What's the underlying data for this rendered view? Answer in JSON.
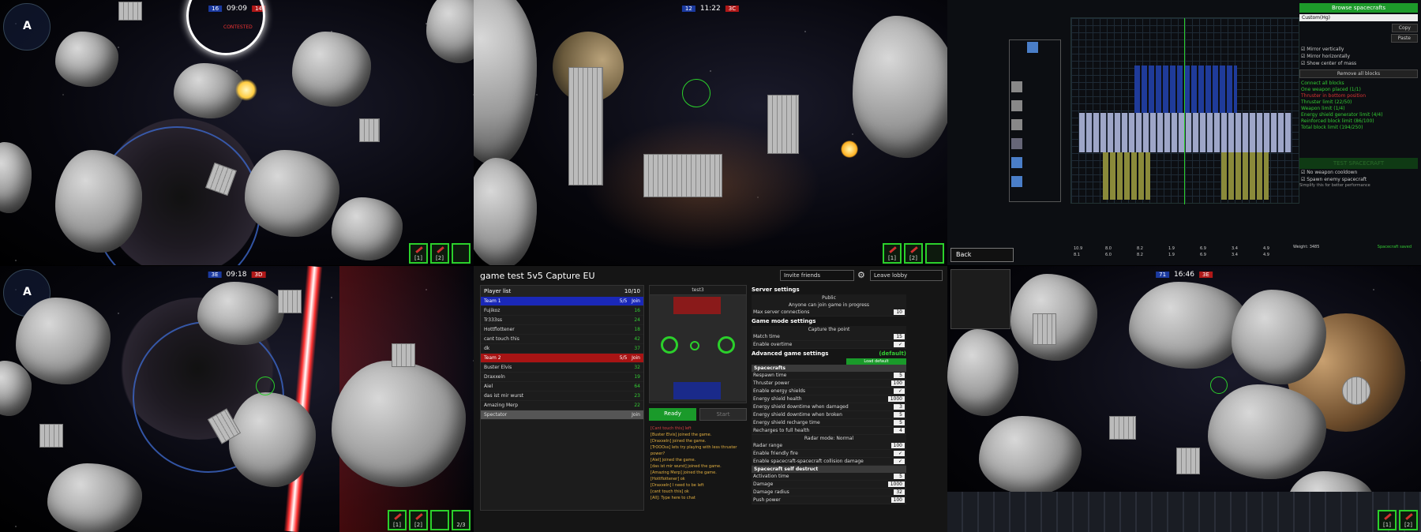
{
  "panels": {
    "tl": {
      "timer": "09:09",
      "team_blue": "16",
      "team_red": "14",
      "status": "CONTESTED",
      "weapons": [
        "[1]",
        "[2]",
        ""
      ]
    },
    "tc": {
      "timer": "11:22",
      "team_blue": "12",
      "team_red": "3C",
      "weapons": [
        "[1]",
        "[2]",
        ""
      ]
    },
    "bl": {
      "timer": "09:18",
      "team_blue": "3E",
      "team_red": "3D",
      "weapons": [
        "[1]",
        "[2]",
        "",
        "2/3"
      ]
    },
    "br": {
      "timer": "16:46",
      "team_blue": "71",
      "team_red": "3E",
      "weapons": [
        "[1]",
        "[2]"
      ]
    }
  },
  "lobby": {
    "title": "game test 5v5 Capture EU",
    "invite_label": "Invite friends",
    "leave_label": "Leave lobby",
    "player_list_title": "Player list",
    "player_count": "10/10",
    "teams": [
      {
        "name": "Team 1",
        "count": "5/5",
        "join": "Join",
        "players": [
          {
            "name": "Fujikoz",
            "ping": "16"
          },
          {
            "name": "Tr333ss",
            "ping": "24"
          },
          {
            "name": "Hottflottener",
            "ping": "18"
          },
          {
            "name": "cant touch this",
            "ping": "42"
          },
          {
            "name": "dk",
            "ping": "37"
          }
        ]
      },
      {
        "name": "Team 2",
        "count": "5/5",
        "join": "Join",
        "players": [
          {
            "name": "Buster Elvis",
            "ping": "32"
          },
          {
            "name": "Draxxeln",
            "ping": "19"
          },
          {
            "name": "Aiel",
            "ping": "64"
          },
          {
            "name": "das ist mir wurst",
            "ping": "23"
          },
          {
            "name": "Amazing Merp",
            "ping": "22"
          }
        ]
      }
    ],
    "spectators_label": "Spectator",
    "spectator_join": "Join",
    "map_name": "test3",
    "ready_label": "Ready",
    "start_label": "Start",
    "chat": [
      "[Cant touch this] left",
      "[Buster Elvis] joined the game.",
      "[Draxxeln] joined the game.",
      "[TrOOOss] lets try playing with less thruster power?",
      "[Aiel] joined the game.",
      "[das ist mir wurst] joined the game.",
      "[Amazing Merp] joined the game.",
      "[Hottflottener] ok",
      "[Draxxeln] I need to be left",
      "[cant touch this] ok",
      "[All]: Type here to chat"
    ],
    "server_settings_title": "Server settings",
    "server_visibility": "Public",
    "server_note": "Anyone can join game in progress",
    "max_server_connections_label": "Max server connections",
    "max_server_connections": "10",
    "game_mode_title": "Game mode settings",
    "game_mode": "Capture the point",
    "match_time_label": "Match time",
    "match_time": "15",
    "overtime_label": "Enable overtime",
    "advanced_title": "Advanced game settings",
    "advanced_default": "(default)",
    "advanced_button": "Load default",
    "spacecrafts_title": "Spacecrafts",
    "advanced_rows": [
      {
        "label": "Respawn time",
        "value": "5"
      },
      {
        "label": "Thruster power",
        "value": "100"
      },
      {
        "label": "Enable energy shields",
        "value": "✓"
      },
      {
        "label": "Energy shield health",
        "value": "1000"
      },
      {
        "label": "Energy shield downtime when damaged",
        "value": "3"
      },
      {
        "label": "Energy shield downtime when broken",
        "value": "5"
      },
      {
        "label": "Energy shield recharge time",
        "value": "5"
      },
      {
        "label": "Recharges to full health",
        "value": "4"
      }
    ],
    "radar_mode": "Radar mode: Normal",
    "radar_rows": [
      {
        "label": "Radar range",
        "value": "100"
      },
      {
        "label": "Enable friendly fire",
        "value": "✓"
      },
      {
        "label": "Enable spacecraft-spacecraft collision damage",
        "value": "✓"
      }
    ],
    "self_destruct_title": "Spacecraft self destruct",
    "self_destruct_rows": [
      {
        "label": "Activation time",
        "value": "5"
      },
      {
        "label": "Damage",
        "value": "1000"
      },
      {
        "label": "Damage radius",
        "value": "32"
      },
      {
        "label": "Push power",
        "value": "100"
      }
    ]
  },
  "editor": {
    "browse_label": "Browse spacecrafts",
    "name_value": "Custom(Hg)",
    "copy_label": "Copy",
    "paste_label": "Paste",
    "mirror_vertically": "Mirror vertically",
    "mirror_horizontally": "Mirror horizontally",
    "show_center_mass": "Show center of mass",
    "remove_all_label": "Remove all blocks",
    "checks": [
      {
        "ok": true,
        "text": "Connect all blocks"
      },
      {
        "ok": true,
        "text": "One weapon placed (1/1)"
      },
      {
        "ok": false,
        "text": "Thruster in bottom position"
      },
      {
        "ok": true,
        "text": "Thruster limit (22/50)"
      },
      {
        "ok": true,
        "text": "Weapon limit (1/4)"
      },
      {
        "ok": true,
        "text": "Energy shield generator limit (4/4)"
      },
      {
        "ok": true,
        "text": "Reinforced block limit (86/100)"
      },
      {
        "ok": true,
        "text": "Total block limit (194/250)"
      }
    ],
    "test_label": "TEST SPACECRAFT",
    "no_weapon_cooldown": "No weapon cooldown",
    "spawn_enemy": "Spawn enemy spacecraft",
    "shortcut_note": "Simplify this for better performance",
    "back_label": "Back",
    "weight_label": "Weight: 3485",
    "green_note": "Spacecraft saved",
    "stats": [
      "10.9",
      "8.0",
      "8.2",
      "1.9",
      "6.9",
      "3.4",
      "4.9",
      "8.1",
      "6.0",
      "8.2",
      "1.9",
      "6.9",
      "3.4",
      "4.9"
    ]
  },
  "colors": {
    "accent_green": "#2bd02b",
    "team_blue": "#1a28b8",
    "team_red": "#a81414"
  }
}
